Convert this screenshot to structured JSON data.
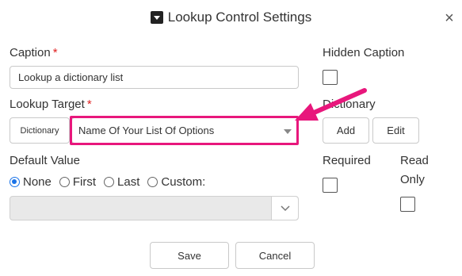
{
  "dialog": {
    "title": "Lookup Control Settings",
    "title_icon": "dropdown-box-icon",
    "close_glyph": "×"
  },
  "caption": {
    "label": "Caption",
    "required_marker": "*",
    "value": "Lookup a dictionary list"
  },
  "hidden_caption": {
    "label": "Hidden Caption",
    "checked": false
  },
  "lookup_target": {
    "label": "Lookup Target",
    "required_marker": "*",
    "type_label": "Dictionary",
    "selected": "Name Of Your List Of Options"
  },
  "dictionary": {
    "label": "Dictionary",
    "add_label": "Add",
    "edit_label": "Edit"
  },
  "default_value": {
    "label": "Default Value",
    "options": [
      "None",
      "First",
      "Last",
      "Custom:"
    ],
    "selected": "None",
    "custom_value": ""
  },
  "required": {
    "label": "Required",
    "checked": false
  },
  "read_only": {
    "label_line1": "Read",
    "label_line2": "Only",
    "checked": false
  },
  "footer": {
    "save_label": "Save",
    "cancel_label": "Cancel"
  },
  "annotation": {
    "highlight_color": "#e8177c",
    "arrow_color": "#e8177c"
  },
  "colors": {
    "accent": "#1a73e8",
    "required": "#e02020"
  }
}
